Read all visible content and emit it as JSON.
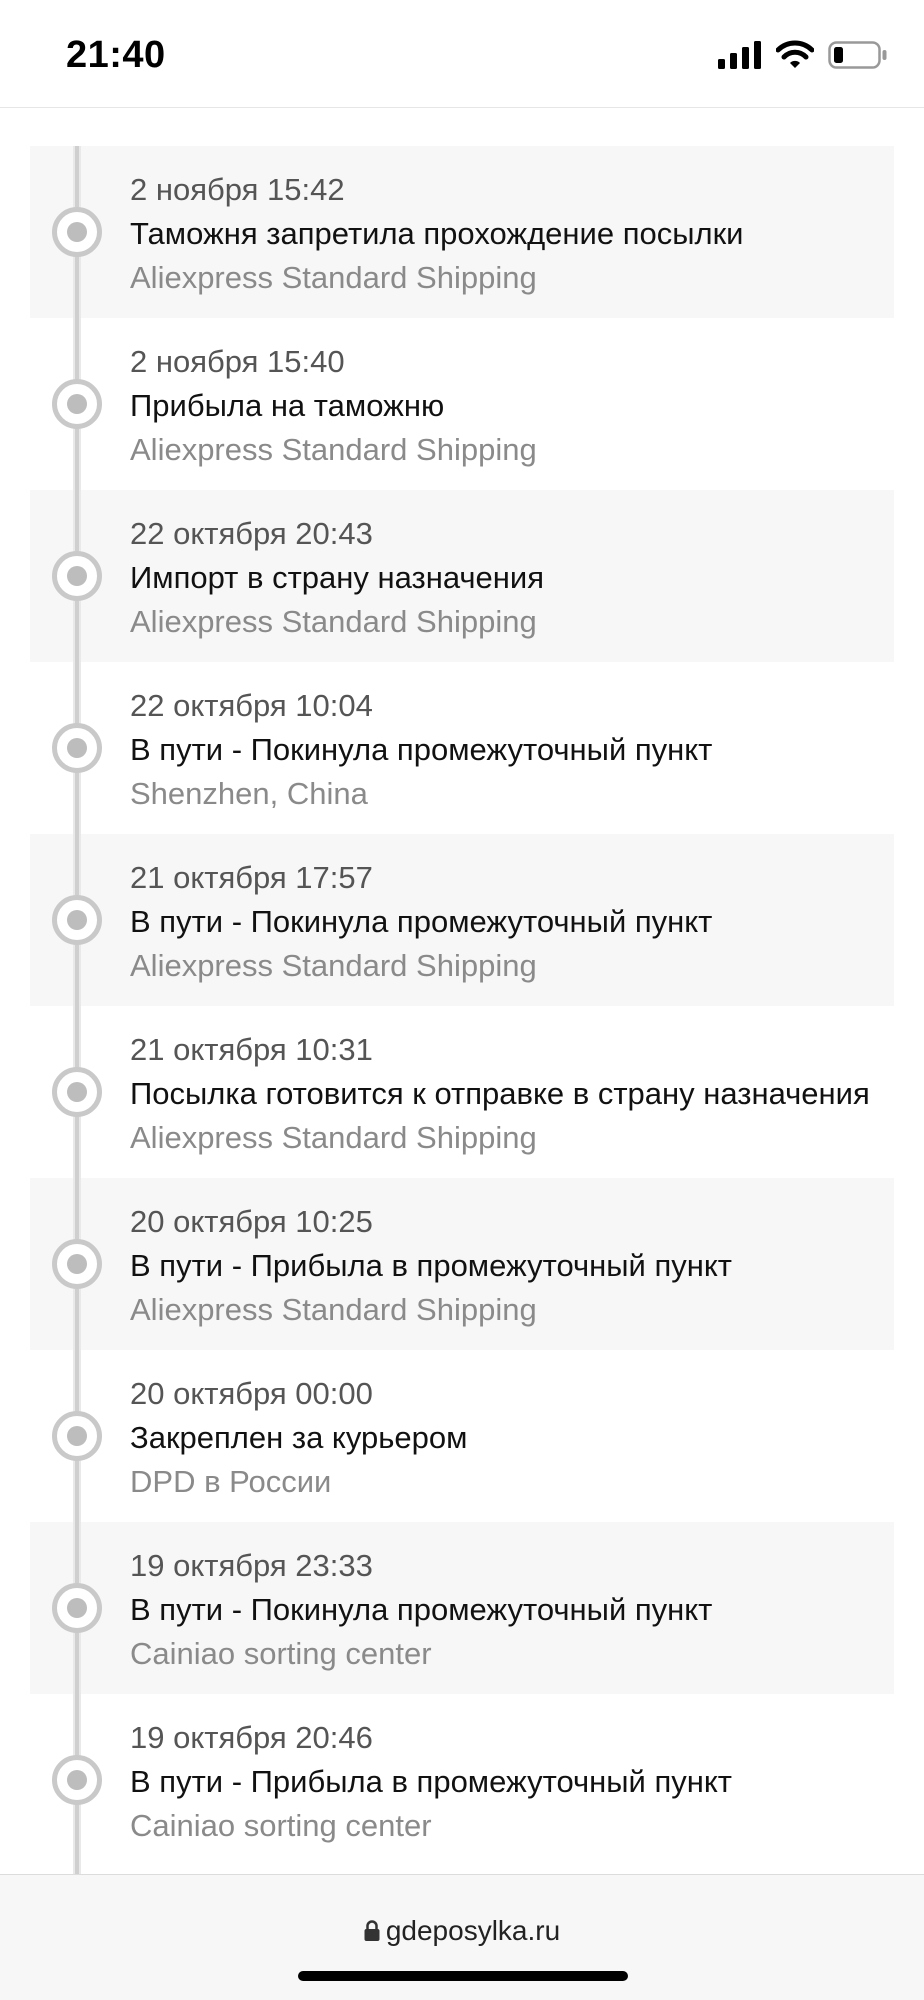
{
  "status_bar": {
    "time": "21:40"
  },
  "events": [
    {
      "date": "2 ноября 15:42",
      "title": "Таможня запретила прохождение посылки",
      "carrier": "Aliexpress Standard Shipping"
    },
    {
      "date": "2 ноября 15:40",
      "title": "Прибыла на таможню",
      "carrier": "Aliexpress Standard Shipping"
    },
    {
      "date": "22 октября 20:43",
      "title": "Импорт в страну назначения",
      "carrier": "Aliexpress Standard Shipping"
    },
    {
      "date": "22 октября 10:04",
      "title": "В пути - Покинула промежуточный пункт",
      "carrier": "Shenzhen, China"
    },
    {
      "date": "21 октября 17:57",
      "title": "В пути - Покинула промежуточный пункт",
      "carrier": "Aliexpress Standard Shipping"
    },
    {
      "date": "21 октября 10:31",
      "title": "Посылка готовится к отправке в страну назначения",
      "carrier": "Aliexpress Standard Shipping"
    },
    {
      "date": "20 октября 10:25",
      "title": "В пути - Прибыла в промежуточный пункт",
      "carrier": "Aliexpress Standard Shipping"
    },
    {
      "date": "20 октября 00:00",
      "title": "Закреплен за курьером",
      "carrier": "DPD в России"
    },
    {
      "date": "19 октября 23:33",
      "title": "В пути - Покинула промежуточный пункт",
      "carrier": "Cainiao sorting center"
    },
    {
      "date": "19 октября 20:46",
      "title": "В пути - Прибыла в промежуточный пункт",
      "carrier": "Cainiao sorting center"
    }
  ],
  "browser": {
    "url": "gdeposylka.ru",
    "lock_icon": "lock-icon"
  }
}
